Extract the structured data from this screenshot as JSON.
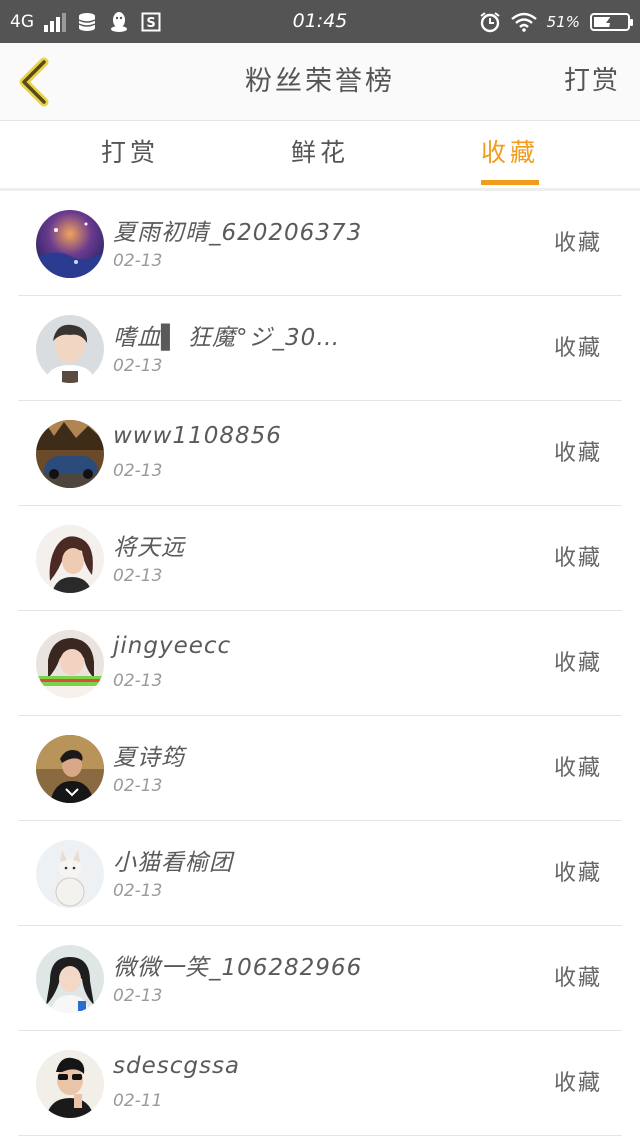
{
  "status_bar": {
    "network": "4G",
    "time": "01:45",
    "battery": "51%",
    "battery_level": 0.51
  },
  "header": {
    "title": "粉丝荣誉榜",
    "action": "打赏"
  },
  "tabs": [
    {
      "label": "打赏"
    },
    {
      "label": "鲜花"
    },
    {
      "label": "收藏"
    }
  ],
  "active_tab": 2,
  "accent_color": "#f29c1c",
  "fans": [
    {
      "name": "夏雨初晴_620206373",
      "date": "02-13",
      "action": "收藏"
    },
    {
      "name": "嗜血▌ 狂魔°ジ_30…",
      "date": "02-13",
      "action": "收藏"
    },
    {
      "name": "www1108856",
      "date": "02-13",
      "action": "收藏"
    },
    {
      "name": "将天远",
      "date": "02-13",
      "action": "收藏"
    },
    {
      "name": "jingyeecc",
      "date": "02-13",
      "action": "收藏"
    },
    {
      "name": "夏诗筠",
      "date": "02-13",
      "action": "收藏"
    },
    {
      "name": "小猫看榆团",
      "date": "02-13",
      "action": "收藏"
    },
    {
      "name": "微微一笑_106282966",
      "date": "02-13",
      "action": "收藏"
    },
    {
      "name": "sdescgssa",
      "date": "02-11",
      "action": "收藏"
    }
  ]
}
